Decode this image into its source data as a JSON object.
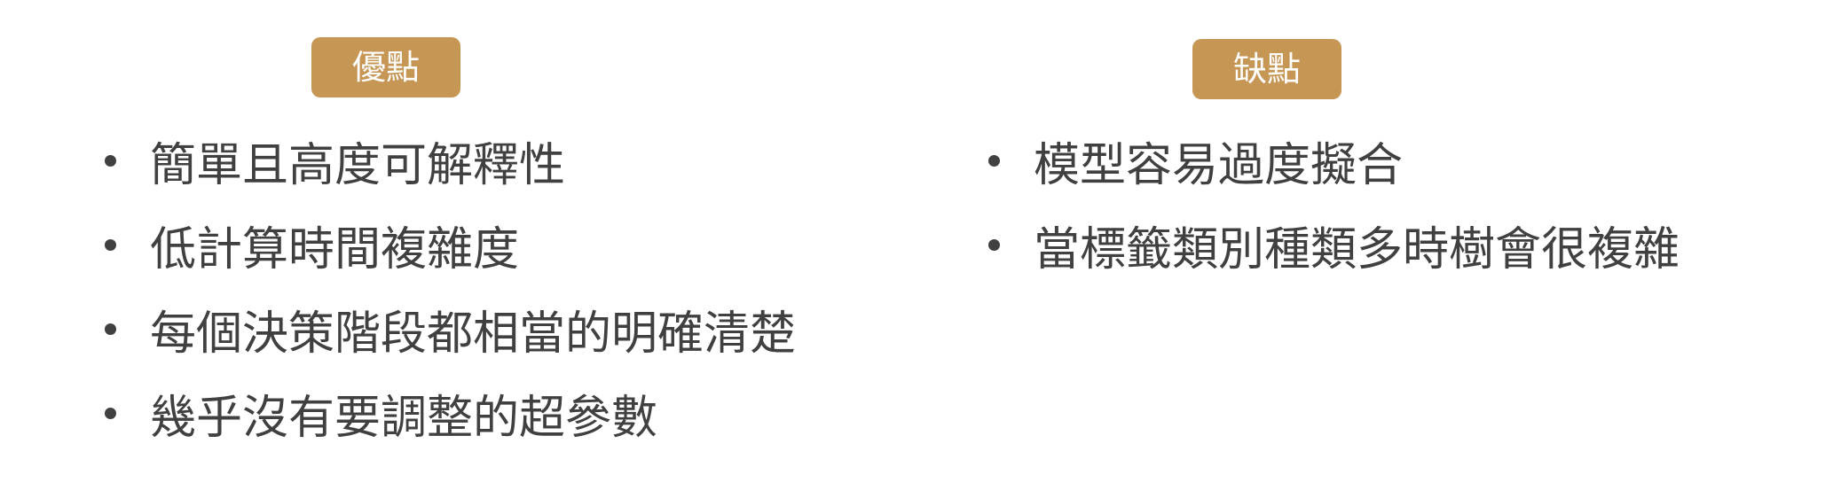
{
  "colors": {
    "badge_background": "#c69655",
    "badge_text": "#ffffff",
    "body_text": "#404040"
  },
  "pros": {
    "label": "優點",
    "items": [
      "簡單且高度可解釋性",
      "低計算時間複雜度",
      "每個決策階段都相當的明確清楚",
      "幾乎沒有要調整的超參數"
    ]
  },
  "cons": {
    "label": "缺點",
    "items": [
      "模型容易過度擬合",
      "當標籤類別種類多時樹會很複雜"
    ]
  }
}
